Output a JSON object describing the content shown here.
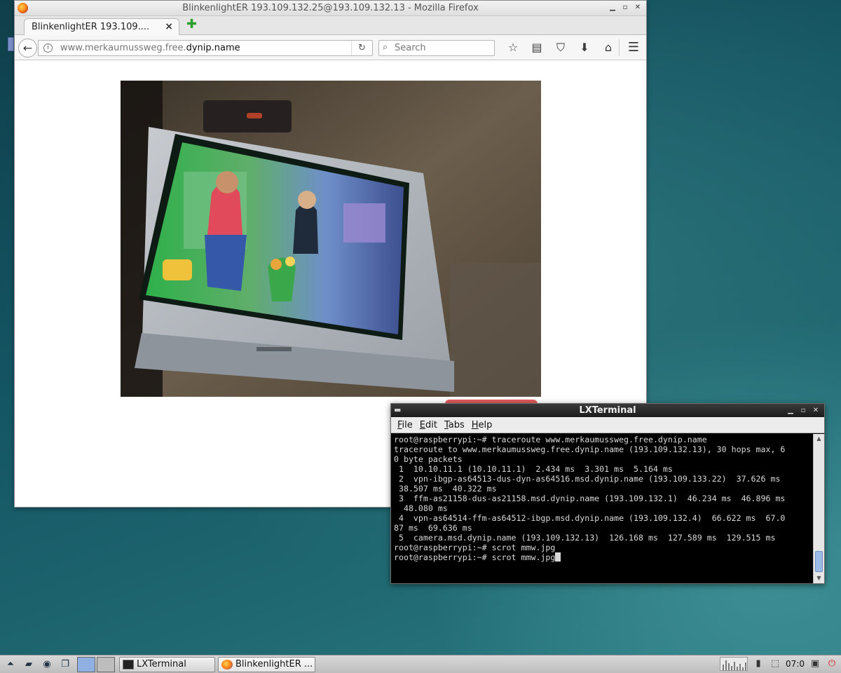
{
  "firefox": {
    "window_title": "BlinkenlightER 193.109.132.25@193.109.132.13 - Mozilla Firefox",
    "tab_title": "BlinkenlightER 193.109....",
    "url_prefix": "www.merkaumussweg.free.",
    "url_domain": "dynip.name",
    "search_placeholder": "Search",
    "toolbar_icons": [
      "star-icon",
      "reading-list-icon",
      "pocket-icon",
      "download-icon",
      "home-icon"
    ]
  },
  "terminal": {
    "title": "LXTerminal",
    "menu": [
      "File",
      "Edit",
      "Tabs",
      "Help"
    ],
    "lines": [
      "root@raspberrypi:~# traceroute www.merkaumussweg.free.dynip.name",
      "traceroute to www.merkaumussweg.free.dynip.name (193.109.132.13), 30 hops max, 6",
      "0 byte packets",
      " 1  10.10.11.1 (10.10.11.1)  2.434 ms  3.301 ms  5.164 ms",
      " 2  vpn-ibgp-as64513-dus-dyn-as64516.msd.dynip.name (193.109.133.22)  37.626 ms",
      " 38.507 ms  40.322 ms",
      " 3  ffm-as21158-dus-as21158.msd.dynip.name (193.109.132.1)  46.234 ms  46.896 ms",
      "  48.080 ms",
      " 4  vpn-as64514-ffm-as64512-ibgp.msd.dynip.name (193.109.132.4)  66.622 ms  67.0",
      "87 ms  69.636 ms",
      " 5  camera.msd.dynip.name (193.109.132.13)  126.168 ms  127.589 ms  129.515 ms",
      "root@raspberrypi:~# scrot mmw.jpg"
    ],
    "prompt_line": "root@raspberrypi:~# scrot mmw.jpg"
  },
  "taskbar": {
    "tasks": [
      {
        "label": "LXTerminal",
        "icon": "terminal-icon"
      },
      {
        "label": "BlinkenlightER ...",
        "icon": "firefox-icon"
      }
    ],
    "clock": "07:0"
  }
}
